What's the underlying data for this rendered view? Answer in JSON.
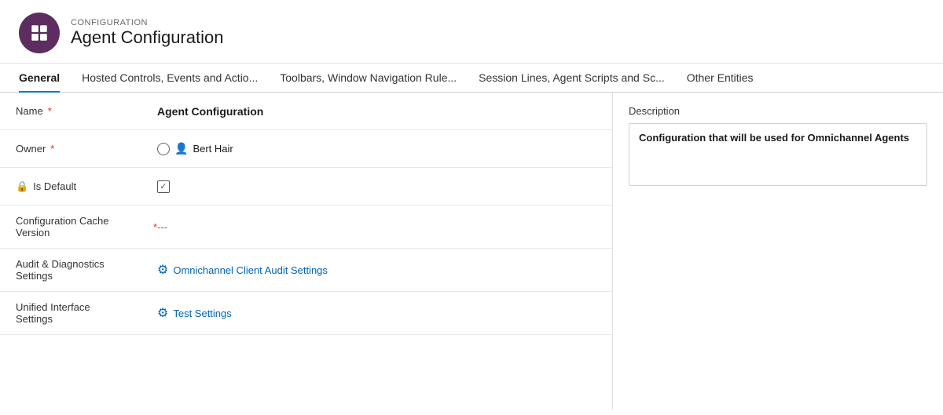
{
  "header": {
    "sub_label": "CONFIGURATION",
    "title": "Agent Configuration",
    "icon_label": "agent-config-icon"
  },
  "tabs": [
    {
      "id": "general",
      "label": "General",
      "active": true
    },
    {
      "id": "hosted",
      "label": "Hosted Controls, Events and Actio...",
      "active": false
    },
    {
      "id": "toolbars",
      "label": "Toolbars, Window Navigation Rule...",
      "active": false
    },
    {
      "id": "session",
      "label": "Session Lines, Agent Scripts and Sc...",
      "active": false
    },
    {
      "id": "other",
      "label": "Other Entities",
      "active": false
    }
  ],
  "form": {
    "name_label": "Name",
    "name_value": "Agent Configuration",
    "owner_label": "Owner",
    "owner_value": "Bert Hair",
    "is_default_label": "Is Default",
    "config_cache_label_line1": "Configuration Cache",
    "config_cache_label_line2": "Version",
    "config_cache_value": "---",
    "audit_label_line1": "Audit & Diagnostics",
    "audit_label_line2": "Settings",
    "audit_link_text": "Omnichannel Client Audit Settings",
    "ui_label_line1": "Unified Interface",
    "ui_label_line2": "Settings",
    "ui_link_text": "Test Settings"
  },
  "description": {
    "label": "Description",
    "value": "Configuration that will be used for Omnichannel Agents"
  },
  "colors": {
    "accent": "#0078d4",
    "required": "#d92e2e",
    "header_bg": "#5c2d5e",
    "link": "#0064b4"
  }
}
